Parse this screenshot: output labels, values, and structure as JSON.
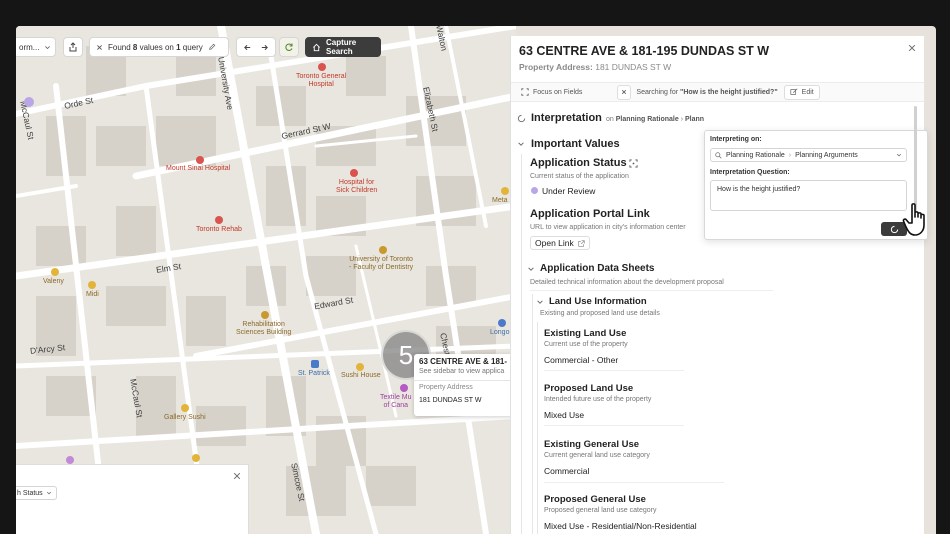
{
  "toolbar": {
    "view_label": "orm...",
    "found_prefix": "Found",
    "found_count": "8",
    "found_mid": "values on",
    "found_queries": "1",
    "found_suffix": "query",
    "capture_label": "Capture Search"
  },
  "map": {
    "streets": [
      {
        "id": "orde",
        "text": "Orde St"
      },
      {
        "id": "mccaul1",
        "text": "McCaul St"
      },
      {
        "id": "university",
        "text": "University Ave"
      },
      {
        "id": "gerrard",
        "text": "Gerrard St W"
      },
      {
        "id": "elizabeth",
        "text": "Elizabeth St"
      },
      {
        "id": "elm",
        "text": "Elm St"
      },
      {
        "id": "edward",
        "text": "Edward St"
      },
      {
        "id": "darcy",
        "text": "D'Arcy St"
      },
      {
        "id": "mccaul2",
        "text": "McCaul St"
      },
      {
        "id": "simcoe",
        "text": "Simcoe St"
      },
      {
        "id": "chest",
        "text": "Chest"
      },
      {
        "id": "walton",
        "text": "Walton"
      }
    ],
    "places": [
      {
        "id": "tgh",
        "text": "Toronto General\nHospital"
      },
      {
        "id": "mtsinai",
        "text": "Mount Sinai Hospital"
      },
      {
        "id": "sickkids",
        "text": "Hospital for\nSick Children"
      },
      {
        "id": "rehab",
        "text": "Toronto Rehab"
      },
      {
        "id": "dentistry",
        "text": "University of Toronto\n- Faculty of Dentistry"
      },
      {
        "id": "valeny",
        "text": "Valeny"
      },
      {
        "id": "midi",
        "text": "Midi"
      },
      {
        "id": "rsb",
        "text": "Rehabilitation\nSciences Building"
      },
      {
        "id": "stpatrick",
        "text": "St. Patrick"
      },
      {
        "id": "sushi",
        "text": "Sushi House"
      },
      {
        "id": "textile",
        "text": "Textile Mu\nof Cana"
      },
      {
        "id": "gallery",
        "text": "Gallery Sushi"
      },
      {
        "id": "longo",
        "text": "Longo"
      },
      {
        "id": "meta",
        "text": "Meta"
      }
    ],
    "cluster_count": "5",
    "popup": {
      "title": "63 CENTRE AVE & 181-",
      "subtitle": "See sidebar to view applica",
      "field_label": "Property Address",
      "field_value": "181 DUNDAS ST W"
    },
    "sheet_filter": "h Status"
  },
  "sidebar": {
    "title": "63 CENTRE AVE & 181-195 DUNDAS ST W",
    "address_label": "Property Address:",
    "address_value": "181 DUNDAS ST W",
    "focus_label": "Focus on Fields",
    "searching_prefix": "Searching for",
    "searching_query": "\"How is the height justified?\"",
    "edit_label": "Edit",
    "interpretation_title": "Interpretation",
    "interpretation_on": "on",
    "interpretation_path": "Planning Rationale",
    "interpretation_path_more": "Plann",
    "important_values": "Important Values",
    "app_status_title": "Application Status",
    "app_status_desc": "Current status of the application",
    "app_status_value": "Under Review",
    "portal_title": "Application Portal Link",
    "portal_desc": "URL to view application in city's information center",
    "open_link": "Open Link",
    "datasheets_title": "Application Data Sheets",
    "datasheets_desc": "Detailed technical information about the development proposal",
    "landuse_title": "Land Use Information",
    "landuse_desc": "Existing and proposed land use details",
    "fields": [
      {
        "title": "Existing Land Use",
        "desc": "Current use of the property",
        "value": "Commercial - Other"
      },
      {
        "title": "Proposed Land Use",
        "desc": "Intended future use of the property",
        "value": "Mixed Use"
      },
      {
        "title": "Existing General Use",
        "desc": "Current general land use category",
        "value": "Commercial"
      },
      {
        "title": "Proposed General Use",
        "desc": "Proposed general land use category",
        "value": "Mixed Use - Residential/Non-Residential"
      }
    ]
  },
  "interpreting": {
    "on_label": "Interpreting on:",
    "crumb1": "Planning Rationale",
    "crumb2": "Planning Arguments",
    "question_label": "Interpretation Question:",
    "question_value": "How is the height justified?"
  },
  "colors": {
    "status_dot": "#b9a6e6",
    "dark_button": "#3c3c3c",
    "map_bg": "#e9e6df"
  }
}
